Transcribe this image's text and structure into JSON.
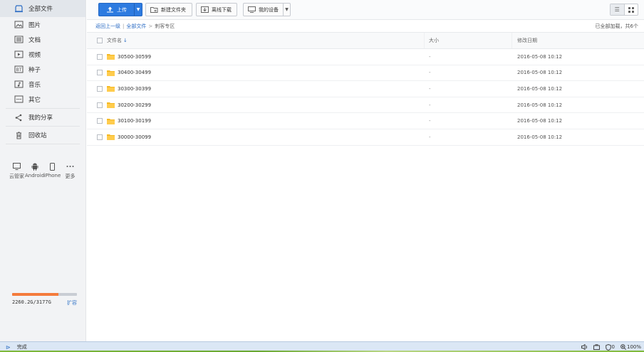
{
  "sidebar": {
    "items": [
      {
        "label": "全部文件",
        "icon": "all-files-icon"
      },
      {
        "label": "图片",
        "icon": "image-icon"
      },
      {
        "label": "文档",
        "icon": "document-icon"
      },
      {
        "label": "视频",
        "icon": "video-icon"
      },
      {
        "label": "种子",
        "icon": "bt-icon"
      },
      {
        "label": "音乐",
        "icon": "music-icon"
      },
      {
        "label": "其它",
        "icon": "other-icon"
      }
    ],
    "share_label": "我的分享",
    "recycle_label": "回收站",
    "devices": [
      {
        "label": "云管家",
        "icon": "monitor-icon"
      },
      {
        "label": "Android",
        "icon": "android-icon"
      },
      {
        "label": "iPhone",
        "icon": "iphone-icon"
      },
      {
        "label": "更多",
        "icon": "more-icon"
      }
    ],
    "quota": {
      "used_text": "2260.2G/3177G",
      "used_fraction": 0.711,
      "expand_label": "扩容"
    }
  },
  "toolbar": {
    "upload_label": "上传",
    "new_folder_label": "新建文件夹",
    "offline_label": "离线下载",
    "devices_label": "我的设备"
  },
  "breadcrumb": {
    "back": "返回上一级",
    "all_files": "全部文件",
    "current": "刺客专区",
    "status": "已全部加载，共6个"
  },
  "table": {
    "headers": {
      "name": "文件名",
      "size": "大小",
      "date": "修改日期"
    },
    "rows": [
      {
        "name": "30500-30599",
        "size": "-",
        "date": "2016-05-08 10:12"
      },
      {
        "name": "30400-30499",
        "size": "-",
        "date": "2016-05-08 10:12"
      },
      {
        "name": "30300-30399",
        "size": "-",
        "date": "2016-05-08 10:12"
      },
      {
        "name": "30200-30299",
        "size": "-",
        "date": "2016-05-08 10:12"
      },
      {
        "name": "30100-30199",
        "size": "-",
        "date": "2016-05-08 10:12"
      },
      {
        "name": "30000-30099",
        "size": "-",
        "date": "2016-05-08 10:12"
      }
    ]
  },
  "statusbar": {
    "done_label": "完成",
    "shield_count": "0",
    "zoom": "100%"
  },
  "colors": {
    "accent": "#2d7be0",
    "quota_fill": "#f47b3c",
    "folder": "#f5b922"
  }
}
